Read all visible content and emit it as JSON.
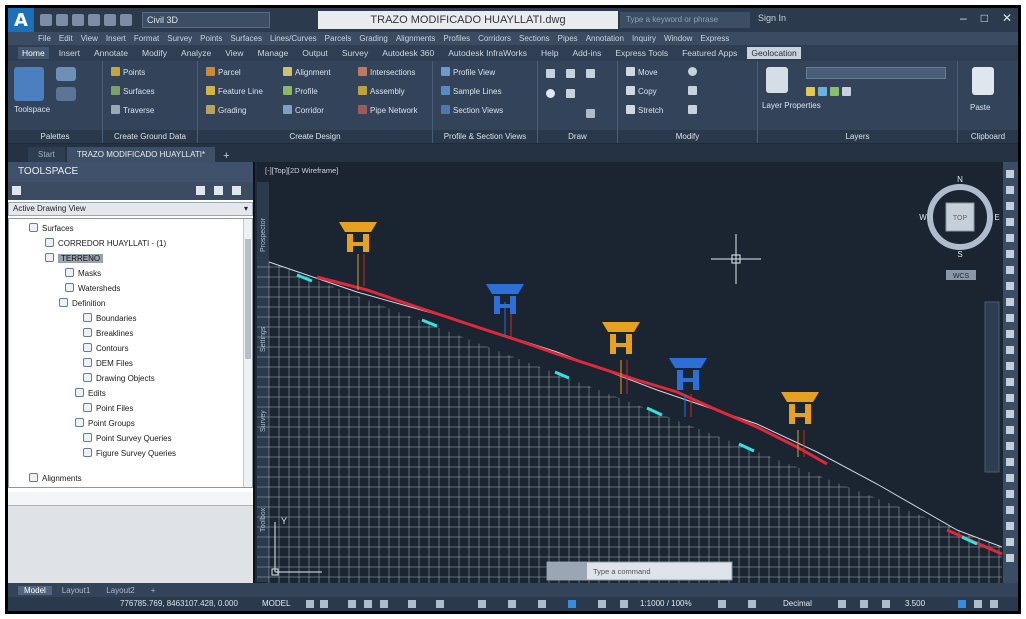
{
  "app": {
    "logo": "A",
    "workspace": "Civil 3D",
    "doc_title": "TRAZO MODIFICADO HUAYLLATI.dwg",
    "search_placeholder": "Type a keyword or phrase",
    "signin": "Sign In",
    "window_controls": [
      "–",
      "□",
      "✕"
    ]
  },
  "menu": [
    "File",
    "Edit",
    "View",
    "Insert",
    "Format",
    "Survey",
    "Points",
    "Surfaces",
    "Lines/Curves",
    "Parcels",
    "Grading",
    "Alignments",
    "Profiles",
    "Corridors",
    "Sections",
    "Pipes",
    "Annotation",
    "Inquiry",
    "Window",
    "Express"
  ],
  "ribbon_tabs": [
    "Home",
    "Insert",
    "Annotate",
    "Modify",
    "Analyze",
    "View",
    "Manage",
    "Output",
    "Survey",
    "Autodesk 360",
    "Autodesk InfraWorks",
    "Help",
    "Add-ins",
    "Express Tools",
    "Featured Apps",
    "Geolocation"
  ],
  "ribbon": {
    "palettes": {
      "title": "Palettes",
      "toolspace": "Toolspace"
    },
    "ground": {
      "title": "Create Ground Data",
      "points": "Points",
      "surfaces": "Surfaces",
      "traverse": "Traverse"
    },
    "design": {
      "title": "Create Design",
      "parcel": "Parcel",
      "feature_line": "Feature Line",
      "grading": "Grading",
      "alignment": "Alignment",
      "profile": "Profile",
      "corridor": "Corridor",
      "intersections": "Intersections",
      "assembly": "Assembly",
      "pipe_network": "Pipe Network"
    },
    "profile_section": {
      "title": "Profile & Section Views",
      "profile_view": "Profile View",
      "sample_lines": "Sample Lines",
      "section_views": "Section Views"
    },
    "draw": {
      "title": "Draw"
    },
    "modify": {
      "title": "Modify",
      "move": "Move",
      "copy": "Copy",
      "stretch": "Stretch"
    },
    "layers": {
      "title": "Layers",
      "layer_properties": "Layer Properties"
    },
    "clipboard": {
      "title": "Clipboard",
      "paste": "Paste"
    }
  },
  "doc_tabs": [
    "Start",
    "TRAZO MODIFICADO HUAYLLATI*",
    "+"
  ],
  "toolspace": {
    "title": "TOOLSPACE",
    "view_select": "Active Drawing View",
    "tree": [
      {
        "label": "Surfaces",
        "level": 0
      },
      {
        "label": "CORREDOR HUAYLLATI - (1)",
        "level": 1
      },
      {
        "label": "TERRENO",
        "level": 1,
        "selected": true
      },
      {
        "label": "Masks",
        "level": 2
      },
      {
        "label": "Watersheds",
        "level": 2
      },
      {
        "label": "Definition",
        "level": 2
      },
      {
        "label": "Boundaries",
        "level": 3
      },
      {
        "label": "Breaklines",
        "level": 3
      },
      {
        "label": "Contours",
        "level": 3
      },
      {
        "label": "DEM Files",
        "level": 3
      },
      {
        "label": "Drawing Objects",
        "level": 3
      },
      {
        "label": "Edits",
        "level": 3
      },
      {
        "label": "Point Files",
        "level": 3
      },
      {
        "label": "Point Groups",
        "level": 3
      },
      {
        "label": "Point Survey Queries",
        "level": 3
      },
      {
        "label": "Figure Survey Queries",
        "level": 3
      },
      {
        "label": "Alignments",
        "level": 0
      }
    ],
    "side_tabs": [
      "Prospector",
      "Settings",
      "Survey",
      "Toolbox"
    ]
  },
  "viewport": {
    "label": "[-][Top][2D Wireframe]",
    "viewcube_face": "TOP",
    "compass": {
      "n": "N",
      "s": "S",
      "e": "E",
      "w": "W"
    },
    "wcs": "WCS",
    "ucs_y": "Y",
    "command_placeholder": "Type a command"
  },
  "layout_tabs": [
    "Model",
    "Layout1",
    "Layout2",
    "+"
  ],
  "status": {
    "coords": "776785.769, 8463107.428, 0.000",
    "model": "MODEL",
    "scale": "1:1000 / 100%",
    "units": "Decimal",
    "zoom": "3.500"
  },
  "colors": {
    "canvas_bg": "#1b2431",
    "grid": "#cfd6df",
    "alignment": "#e0283a",
    "marker_yellow": "#e6a11e",
    "marker_blue": "#2d6fd6",
    "cyan_dash": "#36e0e0"
  }
}
